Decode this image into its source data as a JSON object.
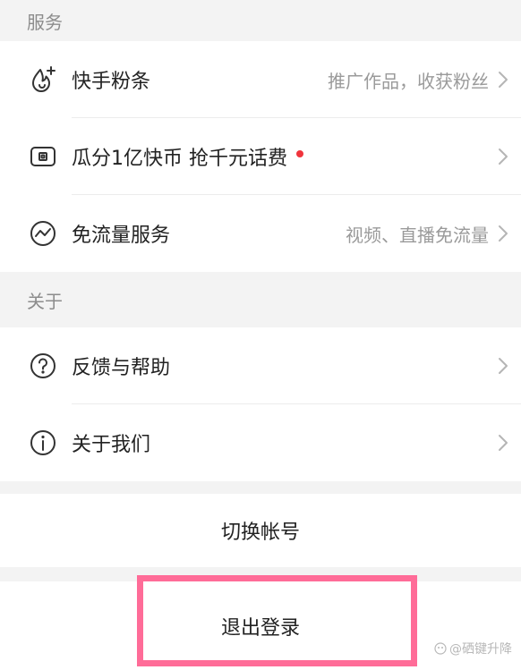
{
  "sections": {
    "services_title": "服务",
    "about_title": "关于"
  },
  "services": [
    {
      "label": "快手粉条",
      "hint": "推广作品，收获粉丝",
      "icon": "flame-plus-icon"
    },
    {
      "label": "瓜分1亿快币 抢千元话费",
      "hint": "",
      "icon": "wallet-card-icon",
      "badge": "red-dot"
    },
    {
      "label": "免流量服务",
      "hint": "视频、直播免流量",
      "icon": "trend-circle-icon"
    }
  ],
  "about": [
    {
      "label": "反馈与帮助",
      "icon": "question-circle-icon"
    },
    {
      "label": "关于我们",
      "icon": "info-circle-icon"
    }
  ],
  "actions": {
    "switch_account": "切换帐号",
    "logout": "退出登录"
  },
  "watermark": "@硒键升降",
  "colors": {
    "highlight": "#ff6c98",
    "badge": "#f0343c",
    "page_bg": "#f3f3f3"
  }
}
